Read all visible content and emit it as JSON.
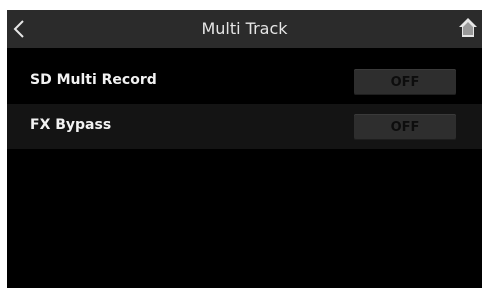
{
  "header": {
    "title": "Multi Track",
    "back_icon": "chevron-left-icon",
    "home_icon": "home-icon"
  },
  "settings": [
    {
      "label": "SD Multi Record",
      "value": "OFF"
    },
    {
      "label": "FX Bypass",
      "value": "OFF"
    }
  ],
  "colors": {
    "background": "#000000",
    "titlebar": "#2b2b2b",
    "row_alt": "#141414",
    "toggle": "#2e2e2e",
    "text": "#f2f2f2"
  }
}
